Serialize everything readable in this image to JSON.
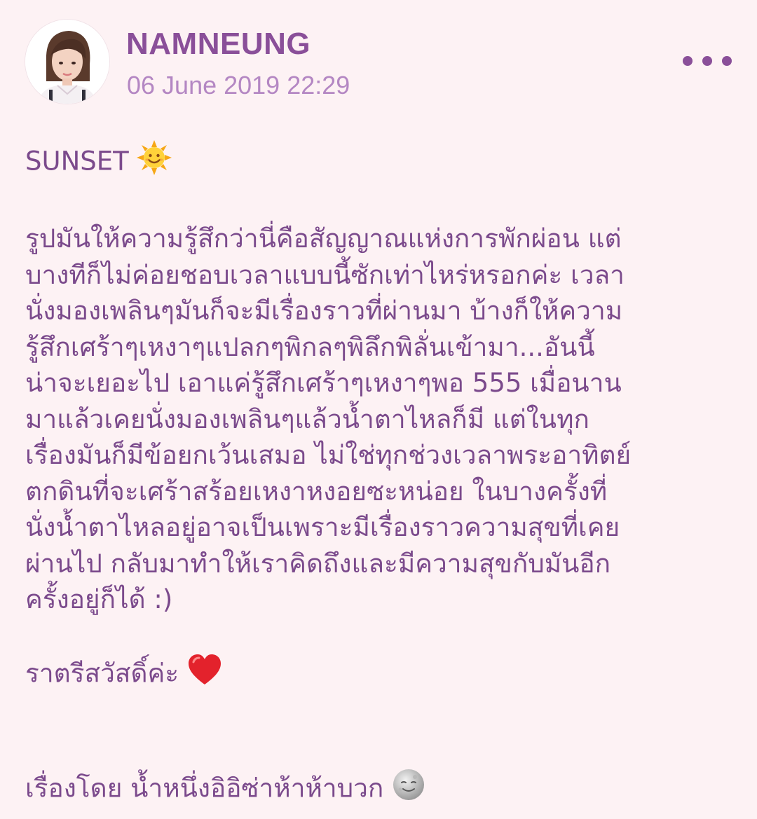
{
  "header": {
    "author": "NAMNEUNG",
    "timestamp": "06 June 2019 22:29"
  },
  "post": {
    "title": "SUNSET",
    "title_emoji": "sun-with-face",
    "body_lines": [
      "รูปมันให้ความรู้สึกว่านี่คือสัญญาณแห่งการพักผ่อน แต่",
      "บางทีก็ไม่ค่อยชอบเวลาแบบนี้ซักเท่าไหร่หรอกค่ะ เวลา",
      "นั่งมองเพลินๆมันก็จะมีเรื่องราวที่ผ่านมา บ้างก็ให้ความ",
      "รู้สึกเศร้าๆเหงาๆแปลกๆพิกลๆพิลึกพิลั่นเข้ามา...อันนี้",
      "น่าจะเยอะไป เอาแค่รู้สึกเศร้าๆเหงาๆพอ 555 เมื่อนาน",
      "มาแล้วเคยนั่งมองเพลินๆแล้วน้ำตาไหลก็มี แต่ในทุก",
      "เรื่องมันก็มีข้อยกเว้นเสมอ ไม่ใช่ทุกช่วงเวลาพระอาทิตย์",
      "ตกดินที่จะเศร้าสร้อยเหงาหงอยซะหน่อย ในบางครั้งที่",
      "นั่งน้ำตาไหลอยู่อาจเป็นเพราะมีเรื่องราวความสุขที่เคย",
      "ผ่านไป กลับมาทำให้เราคิดถึงและมีความสุขกับมันอีก",
      "ครั้งอยู่ก็ได้ :)"
    ],
    "goodnight": "ราตรีสวัสดิ์ค่ะ",
    "goodnight_emoji": "red-heart",
    "signature": "เรื่องโดย น้ำหนึ่งอิอิซ่าห้าห้าบวก",
    "signature_emoji": "grey-moon-face"
  },
  "colors": {
    "background": "#fdf2f4",
    "author": "#8a4f99",
    "timestamp": "#b487c3",
    "text": "#7b4a8c"
  }
}
